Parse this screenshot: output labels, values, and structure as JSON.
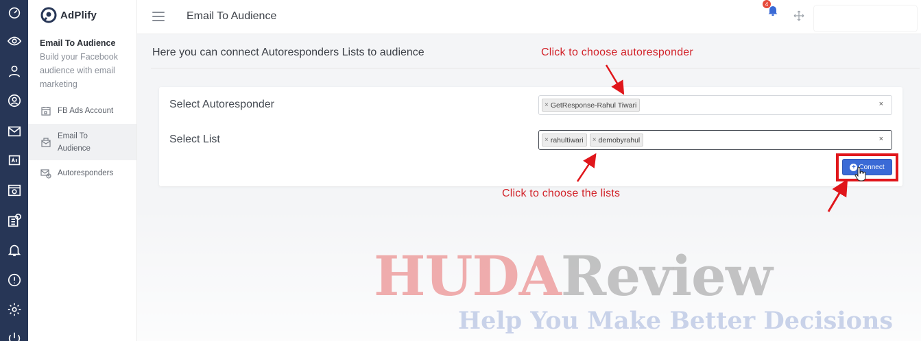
{
  "app": {
    "name": "AdPlify"
  },
  "colors": {
    "rail_bg": "#273656",
    "annotation_red": "#d2232a",
    "connect_blue": "#3a6ad6"
  },
  "rail_icons": [
    "dashboard-icon",
    "eye-icon",
    "user-icon",
    "support-icon",
    "mail-icon",
    "ad-icon",
    "window-icon",
    "facebook-grid-icon",
    "bell-icon",
    "info-icon",
    "settings-icon",
    "power-icon"
  ],
  "sidebar": {
    "title": "Email To Audience",
    "description": "Build your Facebook audience with email marketing",
    "items": [
      {
        "label": "FB Ads Account",
        "icon": "calendar-icon",
        "active": false
      },
      {
        "label": "Email To Audience",
        "icon": "mail-icon",
        "active": true
      },
      {
        "label": "Autoresponders",
        "icon": "autoresponder-icon",
        "active": false
      }
    ]
  },
  "topbar": {
    "title": "Email To Audience",
    "notification_count": "4"
  },
  "content": {
    "headline": "Here you can connect Autoresponders Lists to audience",
    "autoresponder": {
      "label": "Select Autoresponder",
      "selected": [
        "GetResponse-Rahul Tiwari"
      ],
      "clear": "×"
    },
    "list": {
      "label": "Select List",
      "selected": [
        "rahultiwari",
        "demobyrahul"
      ],
      "clear": "×"
    },
    "connect_label": "Connect"
  },
  "annotations": {
    "choose_autoresponder": "Click to choose autoresponder",
    "choose_lists": "Click to choose the lists"
  },
  "watermark": {
    "part1": "HUDA",
    "part2": "Review",
    "tagline": "Help You Make Better Decisions"
  }
}
